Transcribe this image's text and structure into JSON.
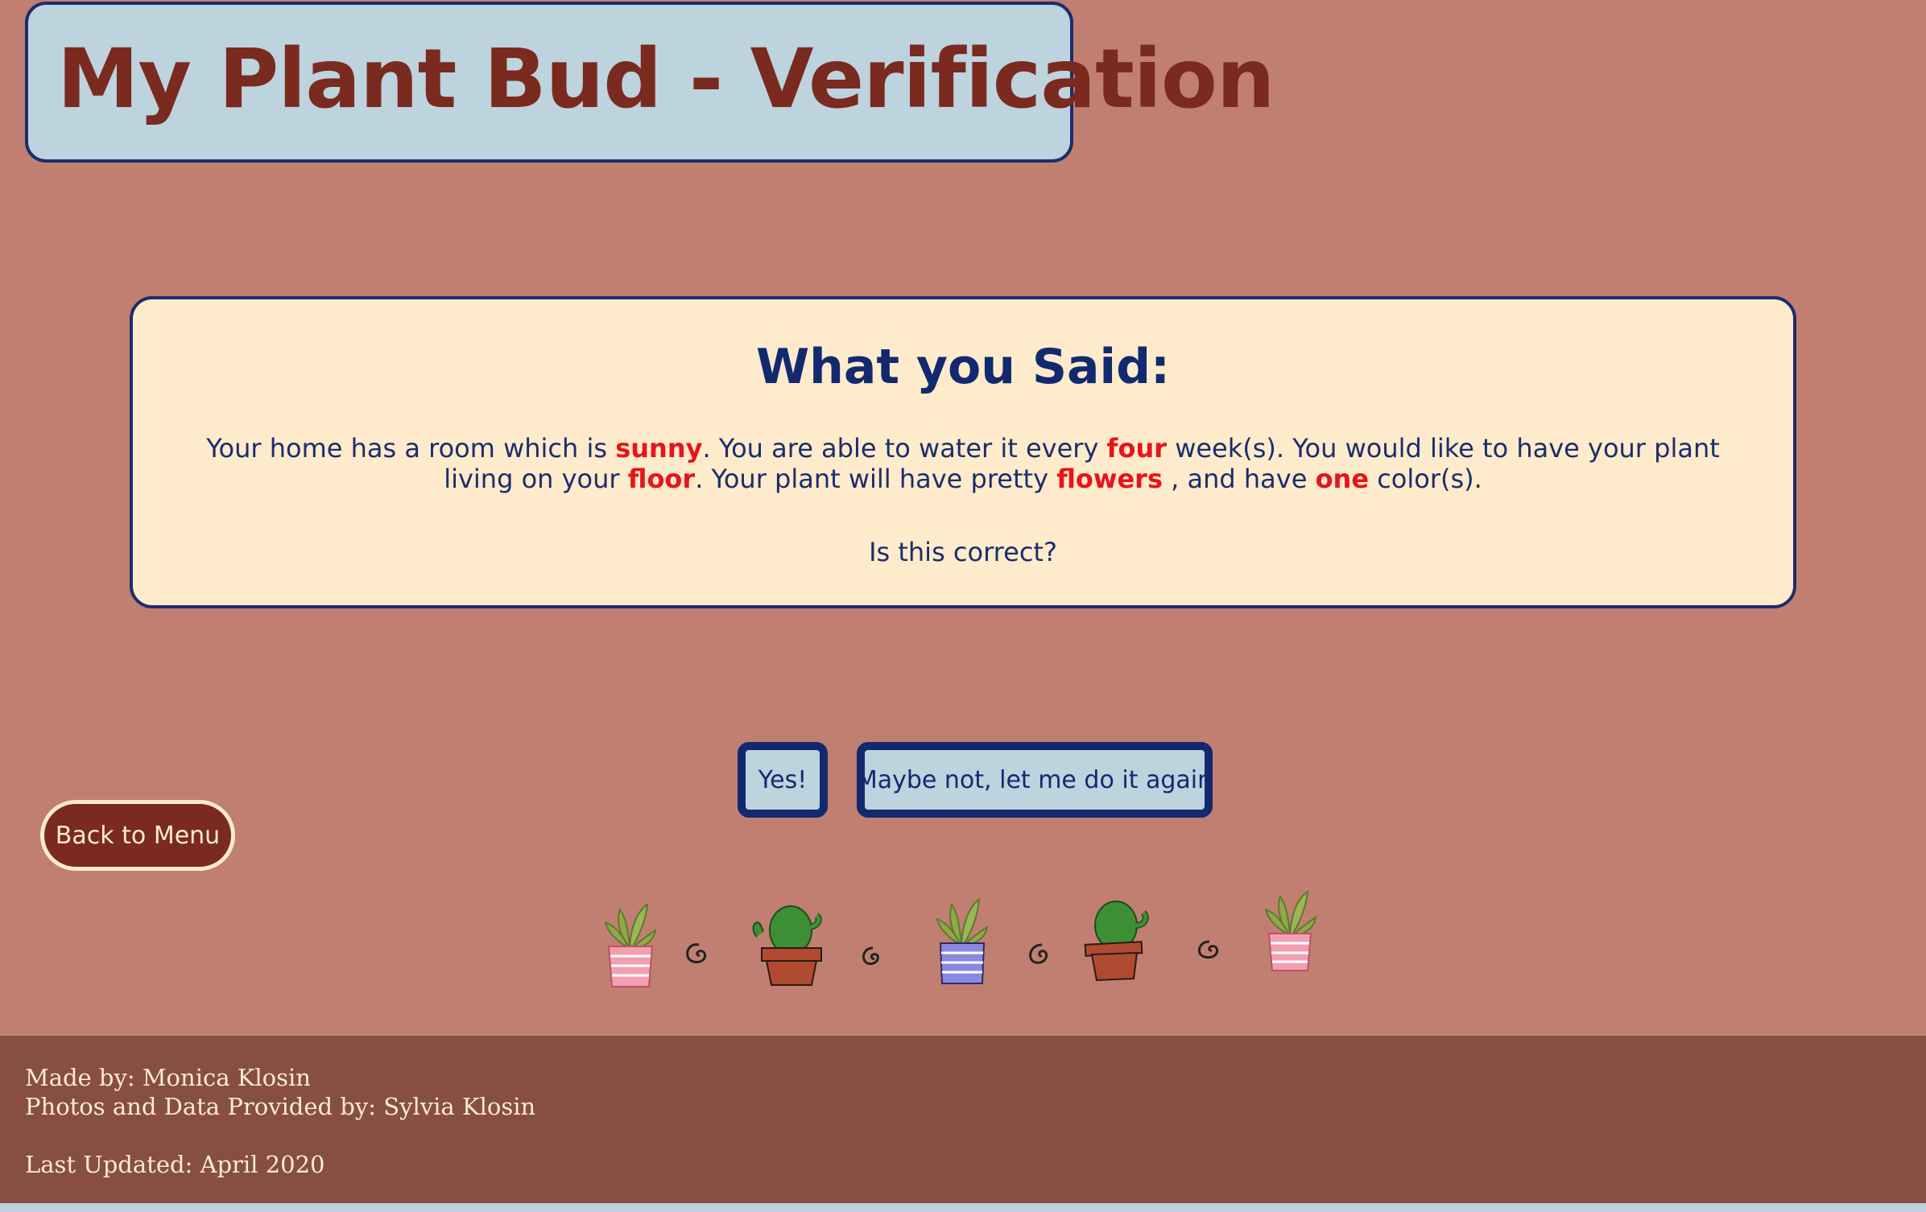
{
  "header": {
    "title": "My Plant Bud - Verification"
  },
  "summary": {
    "heading": "What you Said:",
    "sentence": {
      "p1": "Your home has a room which is ",
      "light": "sunny",
      "p2": ". You are able to water it every ",
      "water": "four",
      "p3": " week(s). You would like to have your plant living on your ",
      "location": "floor",
      "p4": ". Your plant will have pretty ",
      "feature": "flowers",
      "p5": " , and have ",
      "colors": "one",
      "p6": " color(s)."
    },
    "question": "Is this correct?"
  },
  "actions": {
    "yes_label": "Yes!",
    "again_label": "Maybe not, let me do it again",
    "back_label": "Back to Menu"
  },
  "decorations": [
    "succulent-pink-pot-icon",
    "swirl-icon",
    "cactus-pot-icon",
    "swirl-icon",
    "succulent-purple-pot-icon",
    "swirl-icon",
    "cactus-pot-icon",
    "swirl-icon",
    "succulent-pink-pot-icon"
  ],
  "footer": {
    "made_by": "Made by: Monica Klosin",
    "provided_by": "Photos and Data Provided by: Sylvia Klosin",
    "updated": "Last Updated: April 2020"
  },
  "colors": {
    "background": "#c17f72",
    "header_box": "#bdd3de",
    "border_navy": "#1b2d6b",
    "title_red": "#7a2a1e",
    "card": "#fdebcc",
    "highlight": "#e8141a",
    "footer": "#874f44"
  }
}
